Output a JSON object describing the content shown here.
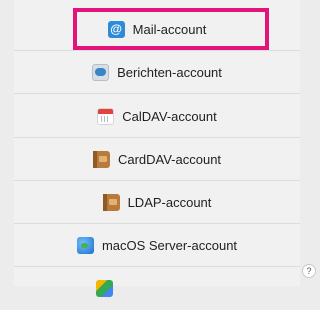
{
  "accounts": [
    {
      "label": "Mail-account",
      "icon": "mail-icon"
    },
    {
      "label": "Berichten-account",
      "icon": "messages-icon"
    },
    {
      "label": "CalDAV-account",
      "icon": "calendar-icon"
    },
    {
      "label": "CardDAV-account",
      "icon": "contacts-book-icon"
    },
    {
      "label": "LDAP-account",
      "icon": "contacts-book-icon"
    },
    {
      "label": "macOS Server-account",
      "icon": "globe-icon"
    },
    {
      "label": "",
      "icon": "google-icon"
    }
  ],
  "mail_icon_glyph": "@",
  "help_label": "?",
  "colors": {
    "highlight": "#e2137a",
    "background": "#f1f1f1"
  }
}
